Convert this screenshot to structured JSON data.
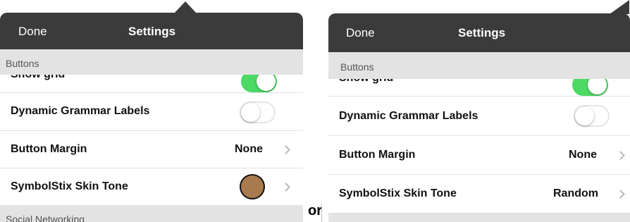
{
  "connector_text": "or",
  "left_panel": {
    "header": {
      "done_label": "Done",
      "title": "Settings"
    },
    "section_buttons": "Buttons",
    "partial_row_label": "Show grid",
    "rows": [
      {
        "label": "Dynamic Grammar Labels",
        "toggle": "off"
      },
      {
        "label": "Button Margin",
        "value": "None"
      },
      {
        "label": "SymbolStix Skin Tone",
        "swatch_color": "#a87a4e"
      }
    ],
    "section_social": "Social Networking"
  },
  "right_panel": {
    "header": {
      "done_label": "Done",
      "title": "Settings"
    },
    "section_buttons": "Buttons",
    "partial_row_label": "Show grid",
    "rows": [
      {
        "label": "Dynamic Grammar Labels",
        "toggle": "off"
      },
      {
        "label": "Button Margin",
        "value": "None"
      },
      {
        "label": "SymbolStix Skin Tone",
        "value": "Random"
      }
    ]
  },
  "colors": {
    "header_bg": "#3b3b3c",
    "toggle_on": "#4cd964",
    "section_bg": "#e3e3e4"
  }
}
